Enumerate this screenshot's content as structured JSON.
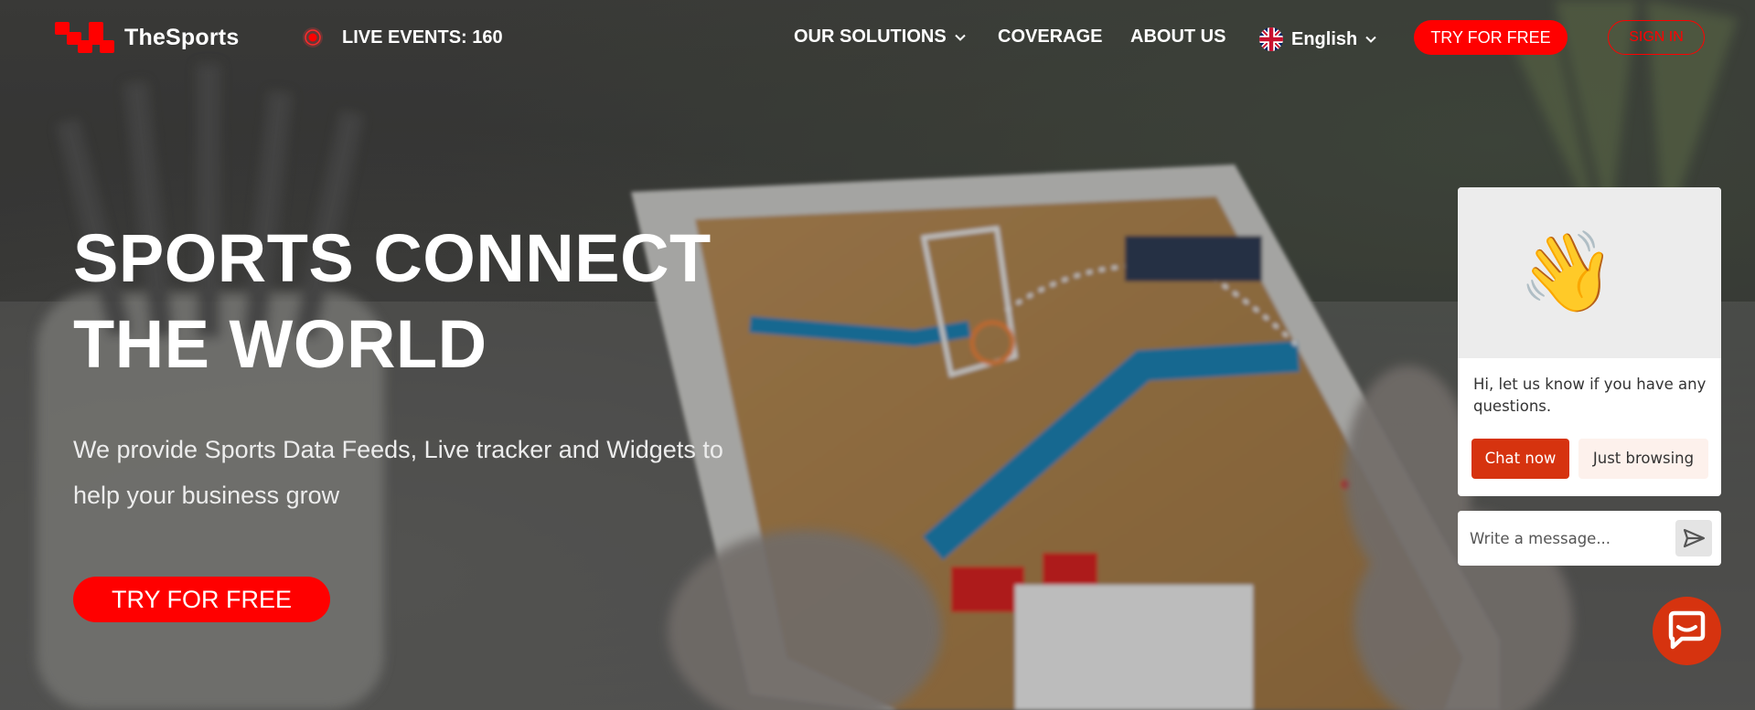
{
  "brand": {
    "name": "TheSports",
    "logo_color": "#ff0000"
  },
  "header": {
    "live_events_label": "LIVE EVENTS: 160",
    "nav": {
      "solutions": "OUR SOLUTIONS",
      "coverage": "COVERAGE",
      "about": "ABOUT US",
      "language": "English"
    },
    "try_label": "TRY FOR FREE",
    "signin_label": "SIGN IN"
  },
  "hero": {
    "title_line1": "SPORTS CONNECT",
    "title_line2": "THE WORLD",
    "subtitle": "We provide Sports Data Feeds, Live tracker and Widgets to help your business grow",
    "cta_label": "TRY FOR FREE"
  },
  "chat": {
    "wave_emoji": "👋",
    "greeting": "Hi, let us know if you have any questions.",
    "chat_now_label": "Chat now",
    "just_browsing_label": "Just browsing",
    "input_placeholder": "Write a message...",
    "accent_color": "#d6330f"
  },
  "icons": {
    "live": "live-record-icon",
    "dropdown": "chevron-down-icon",
    "language_flag": "uk-flag-icon",
    "send": "send-icon",
    "launcher": "chat-bubble-icon"
  }
}
